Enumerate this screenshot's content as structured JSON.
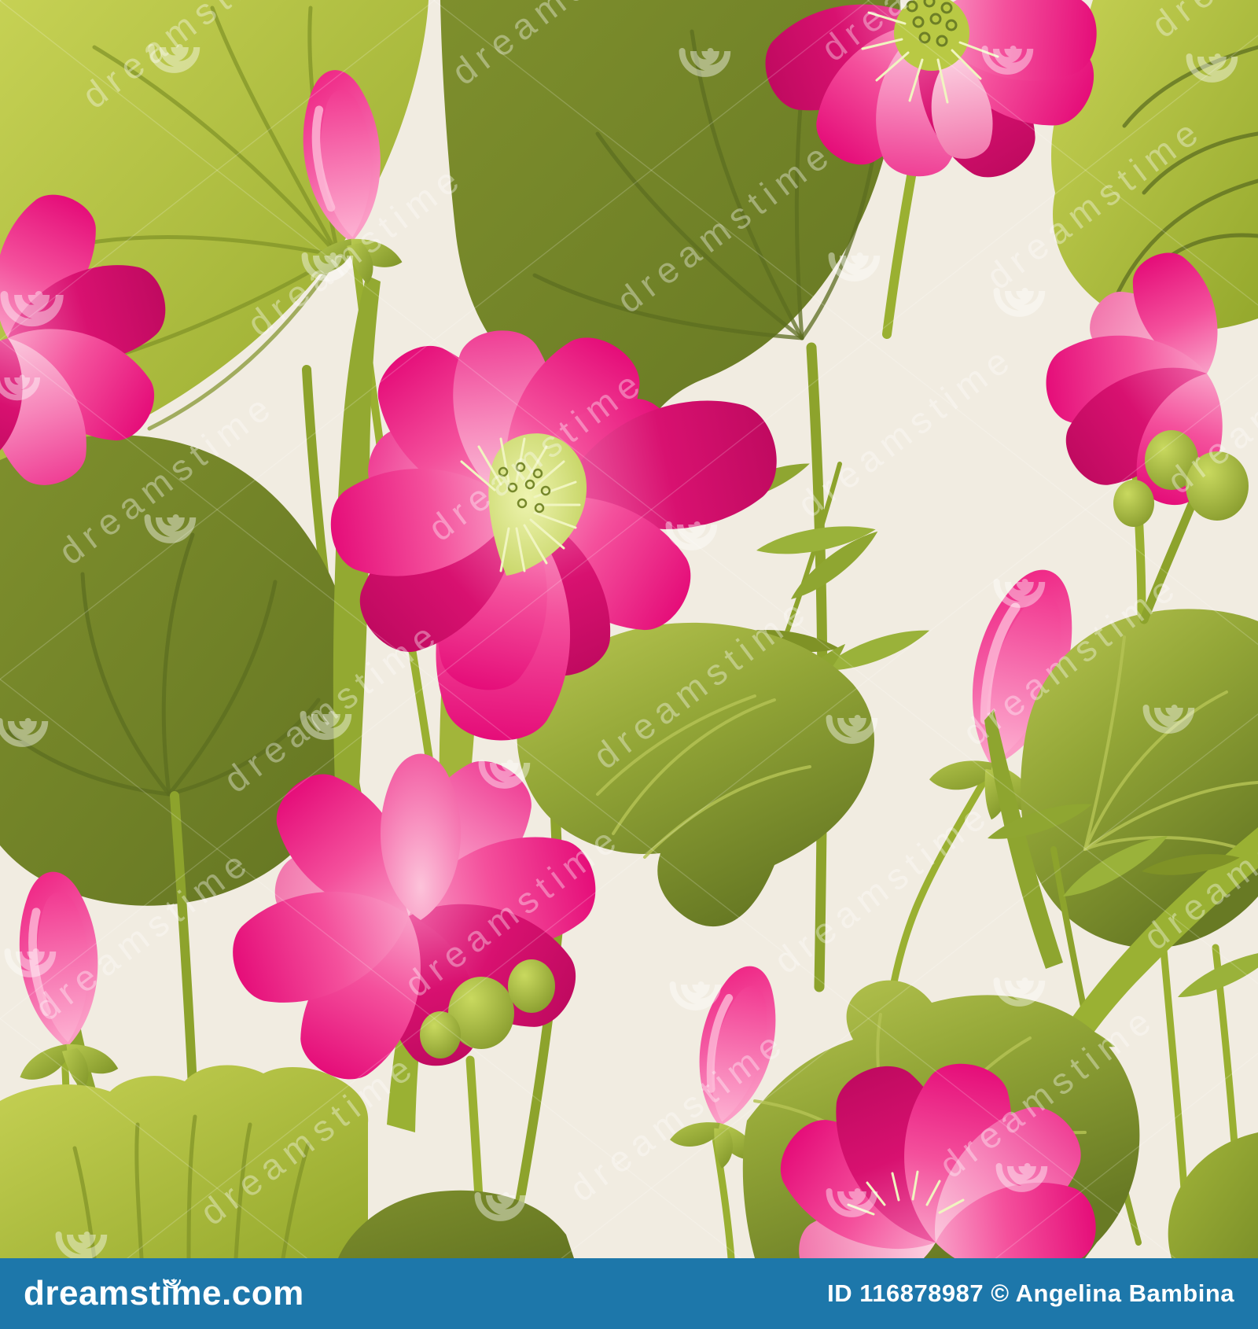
{
  "artwork": {
    "description": "Seamless floral pattern of pink lotus flowers, lotus buds and green lotus leaves on a cream background (watermarked stock illustration preview)"
  },
  "watermark": {
    "text": "dreamstime",
    "spiral_icon": "dreamstime-spiral-logo",
    "color": "#ffffff"
  },
  "footer": {
    "logo": "dreamstime.com",
    "credit": "ID 116878987 © Angelina Bambina"
  },
  "palette": {
    "background_cream": "#f1ece1",
    "footer_blue": "#1d77aa",
    "text_white": "#ffffff",
    "leaf_light": "#b7c64a",
    "leaf_medium": "#8fa430",
    "leaf_dark": "#6f8226",
    "petal_pink": "#f4509c",
    "petal_deep": "#d81170",
    "petal_pale": "#fbc9dd",
    "stamen_yellow": "#e8f2a6",
    "bud_pink": "#ee1b7f",
    "ovary_green": "#a8bf3a"
  }
}
